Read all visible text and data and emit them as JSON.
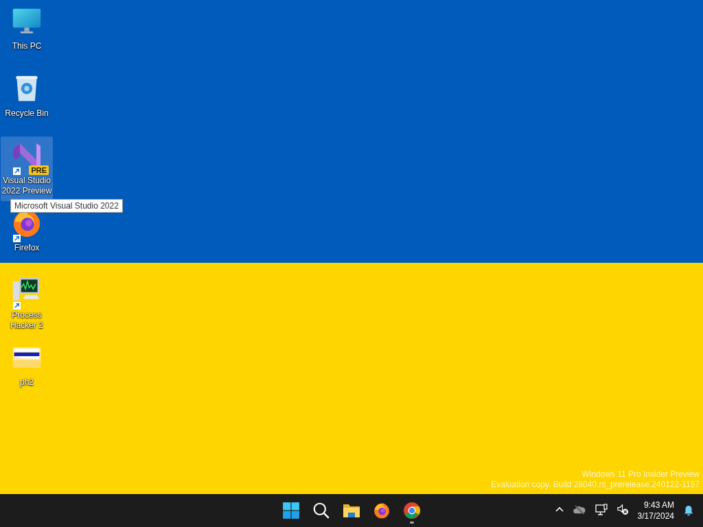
{
  "desktop": {
    "icons": [
      {
        "kind": "monitor",
        "label": "This PC",
        "selected": false,
        "shortcut": false
      },
      {
        "kind": "recycle",
        "label": "Recycle Bin",
        "selected": false,
        "shortcut": false
      },
      {
        "kind": "vs",
        "label": "Visual Studio 2022 Preview",
        "selected": true,
        "shortcut": true,
        "badge": "PRE"
      },
      {
        "kind": "firefox",
        "label": "Firefox",
        "selected": false,
        "shortcut": true
      },
      {
        "kind": "hacker",
        "label": "Process Hacker 2",
        "selected": false,
        "shortcut": true
      },
      {
        "kind": "folder",
        "label": "ph2",
        "selected": false,
        "shortcut": false
      }
    ],
    "tooltip": "Microsoft Visual Studio 2022",
    "watermark": [
      "Windows 11 Pro Insider Preview",
      "Evaluation copy. Build 26040.rs_prerelease.240122-1157"
    ]
  },
  "taskbar": {
    "apps": [
      {
        "kind": "start",
        "running": false
      },
      {
        "kind": "search",
        "running": false
      },
      {
        "kind": "explorer",
        "running": false
      },
      {
        "kind": "firefox",
        "running": false
      },
      {
        "kind": "chrome",
        "running": true
      }
    ],
    "tray": [
      {
        "kind": "chevron"
      },
      {
        "kind": "cloud-off"
      },
      {
        "kind": "network"
      },
      {
        "kind": "volume-muted"
      }
    ],
    "clock": {
      "time": "9:43 AM",
      "date": "3/17/2024"
    }
  }
}
